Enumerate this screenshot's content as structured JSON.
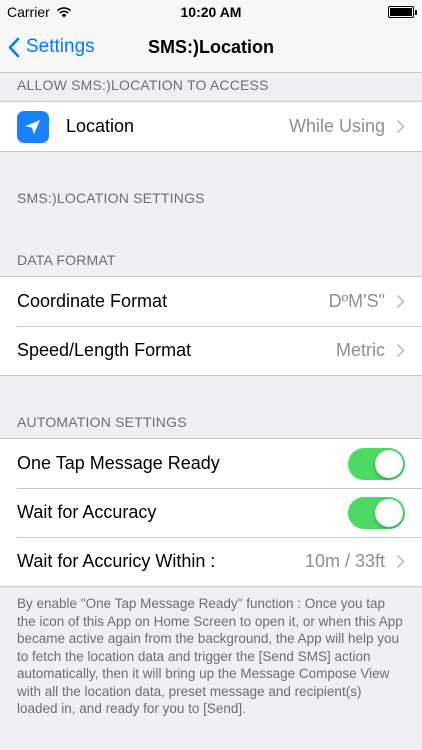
{
  "status_bar": {
    "carrier": "Carrier",
    "time": "10:20 AM"
  },
  "nav": {
    "back_label": "Settings",
    "title": "SMS:)Location"
  },
  "sections": {
    "allow_access": {
      "header": "ALLOW SMS:)LOCATION TO ACCESS",
      "location_label": "Location",
      "location_value": "While Using"
    },
    "app_settings": {
      "header": "SMS:)LOCATION SETTINGS"
    },
    "data_format": {
      "header": "DATA FORMAT",
      "coordinate_label": "Coordinate Format",
      "coordinate_value": "DºM'S\"",
      "speed_label": "Speed/Length Format",
      "speed_value": "Metric"
    },
    "automation": {
      "header": "AUTOMATION SETTINGS",
      "one_tap_label": "One Tap Message Ready",
      "one_tap_on": true,
      "wait_accuracy_label": "Wait for Accuracy",
      "wait_accuracy_on": true,
      "wait_within_label": "Wait for Accuricy Within :",
      "wait_within_value": "10m / 33ft"
    }
  },
  "footer": "By enable \"One Tap Message Ready\" function : Once you tap the icon of this App on Home Screen to open it, or when this App became active again from the background, the App will help you to fetch the location data and trigger the [Send SMS] action automatically, then it will bring up the Message Compose View with all the location data, preset message and recipient(s) loaded in, and ready for you to [Send].",
  "colors": {
    "accent": "#007aff",
    "switch_on": "#4cd964",
    "icon_bg": "#1a82fb"
  }
}
